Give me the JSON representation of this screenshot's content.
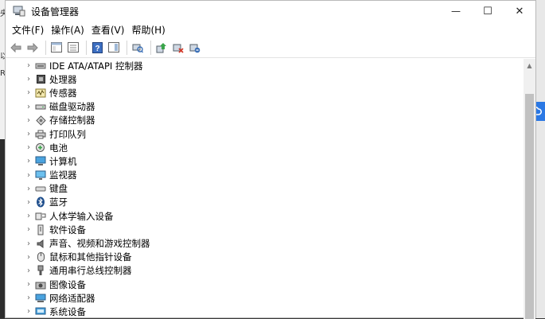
{
  "window": {
    "title": "设备管理器",
    "icon": "device-manager-icon"
  },
  "controls": {
    "minimize": "—",
    "maximize": "☐",
    "close": "✕"
  },
  "menu": [
    "文件(F)",
    "操作(A)",
    "查看(V)",
    "帮助(H)"
  ],
  "toolbar": [
    "back-arrow-icon",
    "forward-arrow-icon",
    "properties-window-icon",
    "console-tree-icon",
    "help-icon",
    "action-pane-icon",
    "scan-hardware-icon",
    "update-driver-icon",
    "disable-device-icon",
    "uninstall-device-icon"
  ],
  "background": {
    "left_texts": [
      "央",
      "以",
      "R"
    ]
  },
  "tree": [
    {
      "label": "IDE ATA/ATAPI 控制器",
      "icon": "ide-controller-icon"
    },
    {
      "label": "处理器",
      "icon": "processor-icon"
    },
    {
      "label": "传感器",
      "icon": "sensor-icon"
    },
    {
      "label": "磁盘驱动器",
      "icon": "disk-drive-icon"
    },
    {
      "label": "存储控制器",
      "icon": "storage-controller-icon"
    },
    {
      "label": "打印队列",
      "icon": "printer-icon"
    },
    {
      "label": "电池",
      "icon": "battery-icon"
    },
    {
      "label": "计算机",
      "icon": "computer-icon"
    },
    {
      "label": "监视器",
      "icon": "monitor-icon"
    },
    {
      "label": "键盘",
      "icon": "keyboard-icon"
    },
    {
      "label": "蓝牙",
      "icon": "bluetooth-icon"
    },
    {
      "label": "人体学输入设备",
      "icon": "hid-icon"
    },
    {
      "label": "软件设备",
      "icon": "software-device-icon"
    },
    {
      "label": "声音、视频和游戏控制器",
      "icon": "sound-icon"
    },
    {
      "label": "鼠标和其他指针设备",
      "icon": "mouse-icon"
    },
    {
      "label": "通用串行总线控制器",
      "icon": "usb-icon"
    },
    {
      "label": "图像设备",
      "icon": "camera-icon"
    },
    {
      "label": "网络适配器",
      "icon": "network-adapter-icon"
    },
    {
      "label": "系统设备",
      "icon": "system-device-icon"
    }
  ]
}
